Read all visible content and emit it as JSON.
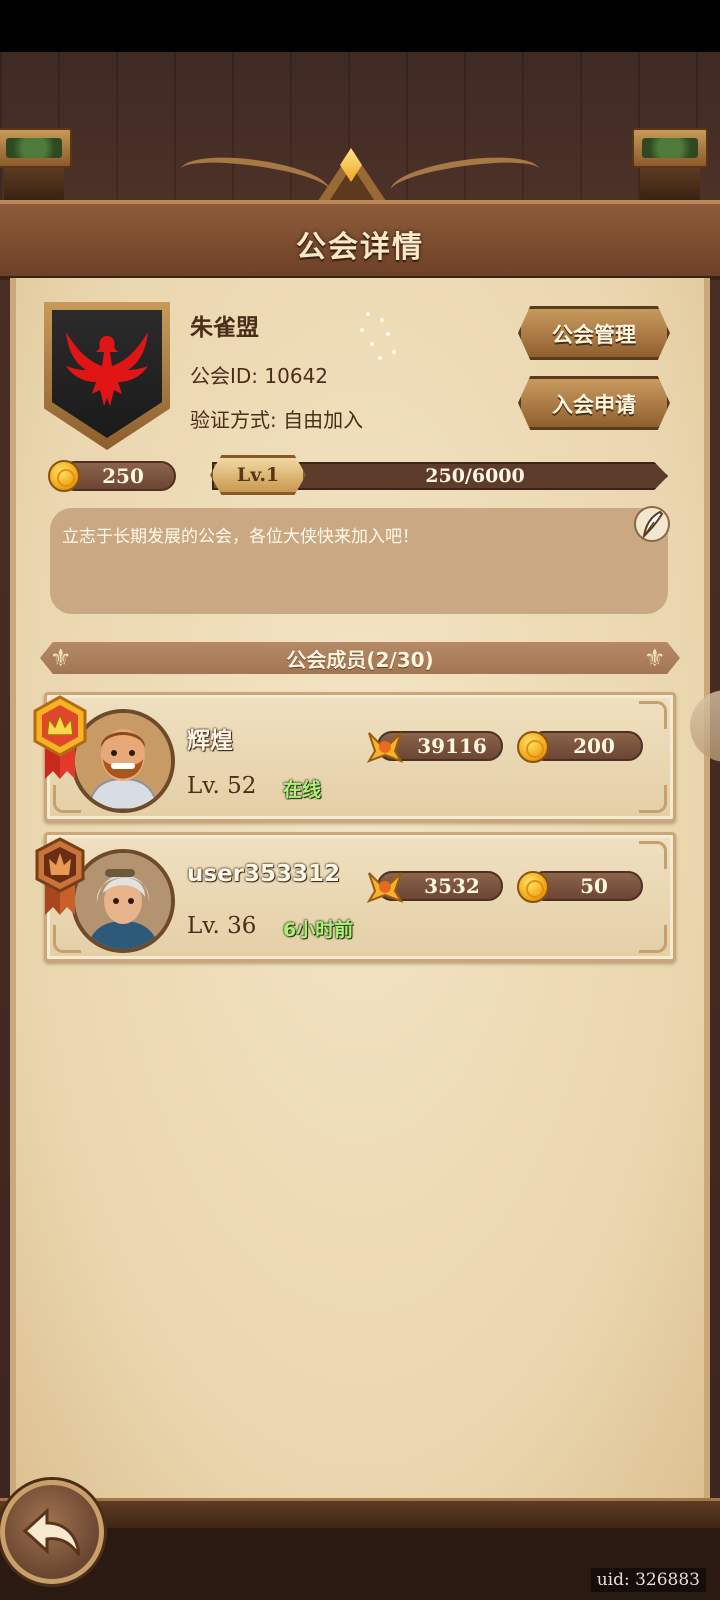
{
  "screen": {
    "title": "公会详情"
  },
  "guild": {
    "name": "朱雀盟",
    "id_text": "公会ID: 10642",
    "verify_text": "验证方式: 自由加入",
    "coins": "250",
    "level": "Lv.1",
    "exp": {
      "current": 250,
      "max": 6000,
      "text": "250/6000"
    },
    "announcement": "立志于长期发展的公会，各位大侠快来加入吧！"
  },
  "buttons": {
    "manage": "公会管理",
    "apply": "入会申请"
  },
  "members_section": {
    "title": "公会成员(2/30)"
  },
  "members": [
    {
      "name": "辉煌",
      "level": "Lv. 52",
      "status": "在线",
      "power": "39116",
      "donation": "200",
      "rank": "leader",
      "status_color": "#aef07a"
    },
    {
      "name": "user353312",
      "level": "Lv. 36",
      "status": "6小时前",
      "power": "3532",
      "donation": "50",
      "rank": "member",
      "status_color": "#aef07a"
    }
  ],
  "footer": {
    "uid": "uid: 326883"
  },
  "colors": {
    "title_text": "#fbe9c5",
    "panel": "#ead6ae",
    "accent_brown": "#6d4128",
    "emblem_red": "#e01616"
  },
  "icons": {
    "emblem": "phoenix-emblem-icon",
    "coin": "gold-coin-icon",
    "power": "crossed-swords-power-icon",
    "edit": "quill-edit-icon",
    "back": "back-arrow-icon",
    "rank_leader": "crown-badge-icon",
    "rank_member": "flame-badge-icon"
  }
}
